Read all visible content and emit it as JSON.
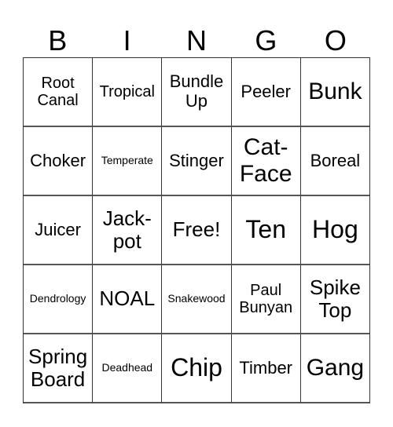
{
  "header": [
    "B",
    "I",
    "N",
    "G",
    "O"
  ],
  "cells": [
    [
      "Root Canal",
      "Tropical",
      "Bundle Up",
      "Peeler",
      "Bunk"
    ],
    [
      "Choker",
      "Temperate",
      "Stinger",
      "Cat-Face",
      "Boreal"
    ],
    [
      "Juicer",
      "Jack-pot",
      "Free!",
      "Ten",
      "Hog"
    ],
    [
      "Dendrology",
      "NOAL",
      "Snakewood",
      "Paul Bunyan",
      "Spike Top"
    ],
    [
      "Spring Board",
      "Deadhead",
      "Chip",
      "Timber",
      "Gang"
    ]
  ]
}
